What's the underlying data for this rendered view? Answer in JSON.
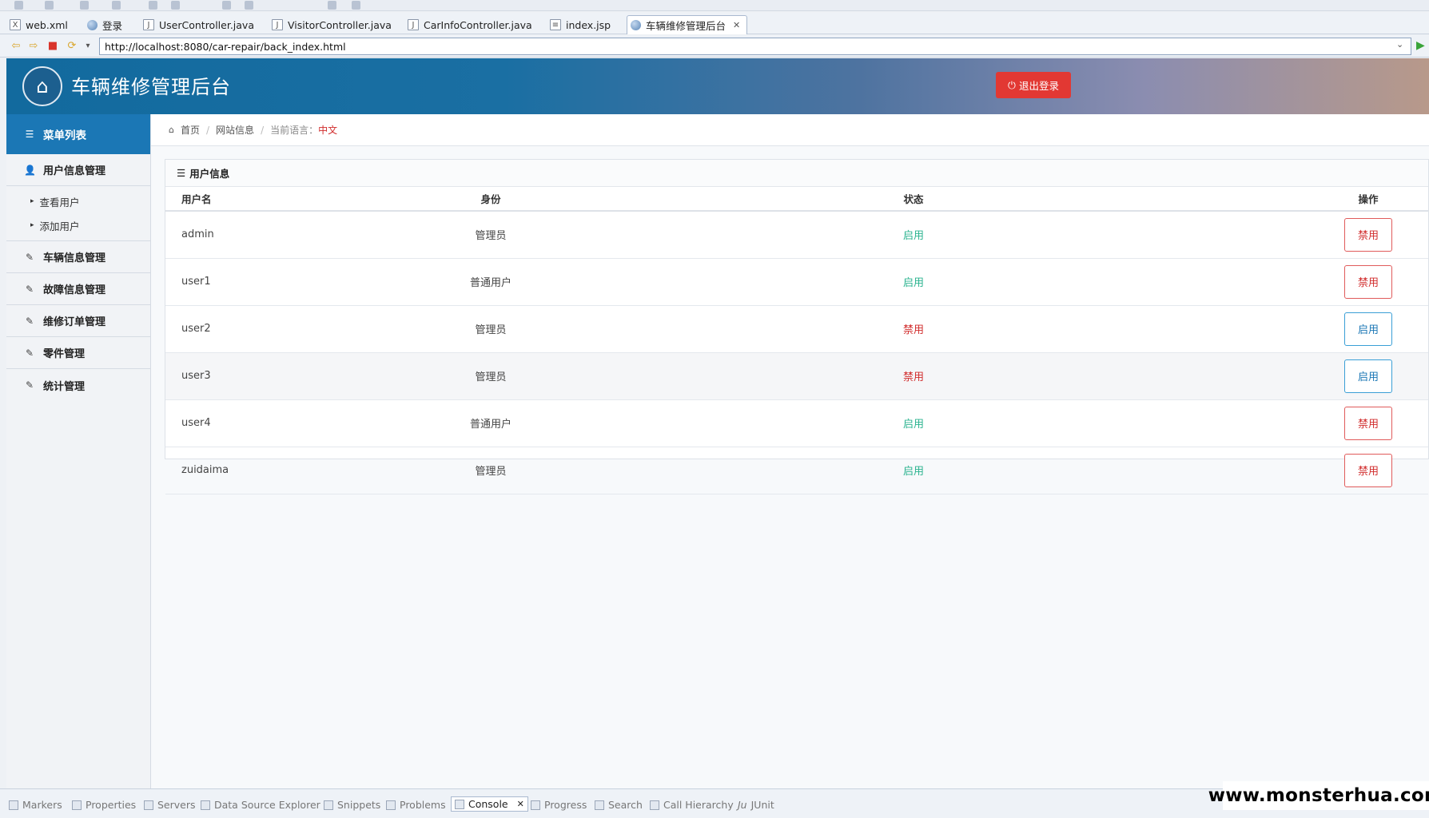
{
  "ide": {
    "tabs": [
      {
        "label": "web.xml",
        "icon": "xml-file-icon"
      },
      {
        "label": "登录",
        "icon": "globe-icon"
      },
      {
        "label": "UserController.java",
        "icon": "java-file-icon"
      },
      {
        "label": "VisitorController.java",
        "icon": "java-file-icon"
      },
      {
        "label": "CarInfoController.java",
        "icon": "java-file-icon"
      },
      {
        "label": "index.jsp",
        "icon": "jsp-file-icon"
      },
      {
        "label": "车辆维修管理后台",
        "icon": "globe-icon",
        "active": true
      }
    ],
    "address": "http://localhost:8080/car-repair/back_index.html",
    "views": [
      {
        "label": "Markers"
      },
      {
        "label": "Properties"
      },
      {
        "label": "Servers"
      },
      {
        "label": "Data Source Explorer"
      },
      {
        "label": "Snippets"
      },
      {
        "label": "Problems"
      },
      {
        "label": "Console",
        "active": true
      },
      {
        "label": "Progress"
      },
      {
        "label": "Search"
      },
      {
        "label": "Call Hierarchy"
      },
      {
        "label": "JUnit"
      }
    ],
    "junit_prefix": "Ju"
  },
  "app": {
    "title": "车辆维修管理后台",
    "logout_label": "退出登录",
    "colors": {
      "accent": "#1b77b5",
      "danger": "#e23833",
      "status_on": "#2bb38f",
      "status_off": "#d12c2c"
    }
  },
  "sidebar": {
    "header": "菜单列表",
    "groups": [
      {
        "label": "用户信息管理",
        "icon": "user-icon",
        "items": [
          "查看用户",
          "添加用户"
        ]
      },
      {
        "label": "车辆信息管理",
        "icon": "edit-icon"
      },
      {
        "label": "故障信息管理",
        "icon": "edit-icon"
      },
      {
        "label": "维修订单管理",
        "icon": "edit-icon"
      },
      {
        "label": "零件管理",
        "icon": "edit-icon"
      },
      {
        "label": "统计管理",
        "icon": "edit-icon"
      }
    ]
  },
  "breadcrumb": {
    "home": "首页",
    "site_info": "网站信息",
    "lang_label": "当前语言：",
    "lang_value": "中文"
  },
  "panel": {
    "title": "用户信息",
    "columns": {
      "name": "用户名",
      "role": "身份",
      "status": "状态",
      "op": "操作"
    },
    "rows": [
      {
        "name": "admin",
        "role": "管理员",
        "status": "启用",
        "op": "禁用"
      },
      {
        "name": "user1",
        "role": "普通用户",
        "status": "启用",
        "op": "禁用"
      },
      {
        "name": "user2",
        "role": "管理员",
        "status": "禁用",
        "op": "启用"
      },
      {
        "name": "user3",
        "role": "管理员",
        "status": "禁用",
        "op": "启用"
      },
      {
        "name": "user4",
        "role": "普通用户",
        "status": "启用",
        "op": "禁用"
      },
      {
        "name": "zuidaima",
        "role": "管理员",
        "status": "启用",
        "op": "禁用"
      }
    ]
  },
  "watermark": "www.monsterhua.com"
}
